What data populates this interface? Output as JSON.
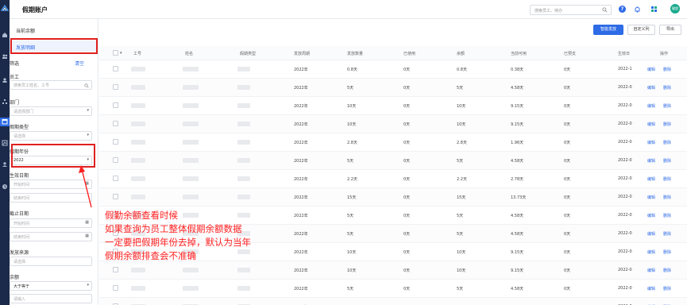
{
  "app": {
    "title": "假期账户",
    "avatar_text": "健超"
  },
  "colors": {
    "accent": "#2e6be6",
    "annotation": "#ff2020",
    "rail": "#1b2a4a"
  },
  "search": {
    "placeholder": "搜索员工、待办"
  },
  "icons": {
    "help": "?",
    "rail": [
      "home-icon",
      "user-group-icon",
      "people-icon",
      "org-icon",
      "calendar-icon",
      "chart-icon",
      "user-icon",
      "clock-icon"
    ]
  },
  "nav": {
    "balance": "当前余额",
    "details": "发放明细"
  },
  "filter": {
    "header": "筛选",
    "clear": "清空",
    "employee": {
      "label": "员工",
      "placeholder": "搜索员工姓名、工号"
    },
    "department": {
      "label": "部门",
      "placeholder": "请选择部门"
    },
    "leave_type": {
      "label": "假期类型",
      "placeholder": "请选择"
    },
    "leave_year": {
      "label": "假期年份",
      "value": "2022"
    },
    "effective_date": {
      "label": "生效日期",
      "start": "开始时间",
      "end": "结束时间"
    },
    "expiry_date": {
      "label": "截止日期",
      "start": "开始时间",
      "end": "结束时间"
    },
    "source": {
      "label": "发放来源",
      "placeholder": "请选择"
    },
    "balance": {
      "label": "余额",
      "op": "大于等于",
      "placeholder": "请输入"
    }
  },
  "toolbar": {
    "smart_grant": "智能发放",
    "custom_columns": "自定义列",
    "export": "导出"
  },
  "table": {
    "headers": [
      "工号",
      "姓名",
      "假期类型",
      "发放周期",
      "发放数量",
      "已使用",
      "余额",
      "当前可用",
      "已预支",
      "生效日",
      "操作"
    ],
    "edit": "编辑",
    "delete": "删除",
    "rows": [
      [
        "2022年",
        "0.8天",
        "0天",
        "0.8天",
        "0.38天",
        "0天",
        "2022-1"
      ],
      [
        "2022年",
        "5天",
        "0天",
        "5天",
        "4.58天",
        "0天",
        "2022-0"
      ],
      [
        "2022年",
        "10天",
        "0天",
        "10天",
        "9.15天",
        "0天",
        "2022-0"
      ],
      [
        "2022年",
        "10天",
        "0天",
        "10天",
        "9.15天",
        "0天",
        "2022-0"
      ],
      [
        "2022年",
        "2.8天",
        "0天",
        "2.8天",
        "1.96天",
        "0天",
        "2022-0"
      ],
      [
        "2022年",
        "5天",
        "0天",
        "5天",
        "4.58天",
        "0天",
        "2022-0"
      ],
      [
        "2022年",
        "2.2天",
        "0天",
        "2.2天",
        "2.78天",
        "0天",
        "2022-0"
      ],
      [
        "2022年",
        "15天",
        "0天",
        "15天",
        "13.73天",
        "0天",
        "2022-0"
      ],
      [
        "2022年",
        "5天",
        "0天",
        "5天",
        "4.58天",
        "0天",
        "2022-0"
      ],
      [
        "2022年",
        "5天",
        "0天",
        "5天",
        "4.58天",
        "0天",
        "2022-0"
      ],
      [
        "2022年",
        "10天",
        "0天",
        "10天",
        "9.15天",
        "0天",
        "2022-0"
      ],
      [
        "2022年",
        "10天",
        "0天",
        "10天",
        "9.15天",
        "0天",
        "2022-0"
      ],
      [
        "2022年",
        "5天",
        "0天",
        "5天",
        "4.58天",
        "0天",
        "2022-0"
      ],
      [
        "2022年",
        "5天",
        "0天",
        "5天",
        "4.58天",
        "0天",
        "2022-0"
      ]
    ]
  },
  "annotation": {
    "lines": [
      "假勤余额查看时候",
      "如果查询为员工整体假期余额数据",
      "一定要把假期年份去掉，默认为当年",
      "假期余额排查会不准确"
    ]
  }
}
